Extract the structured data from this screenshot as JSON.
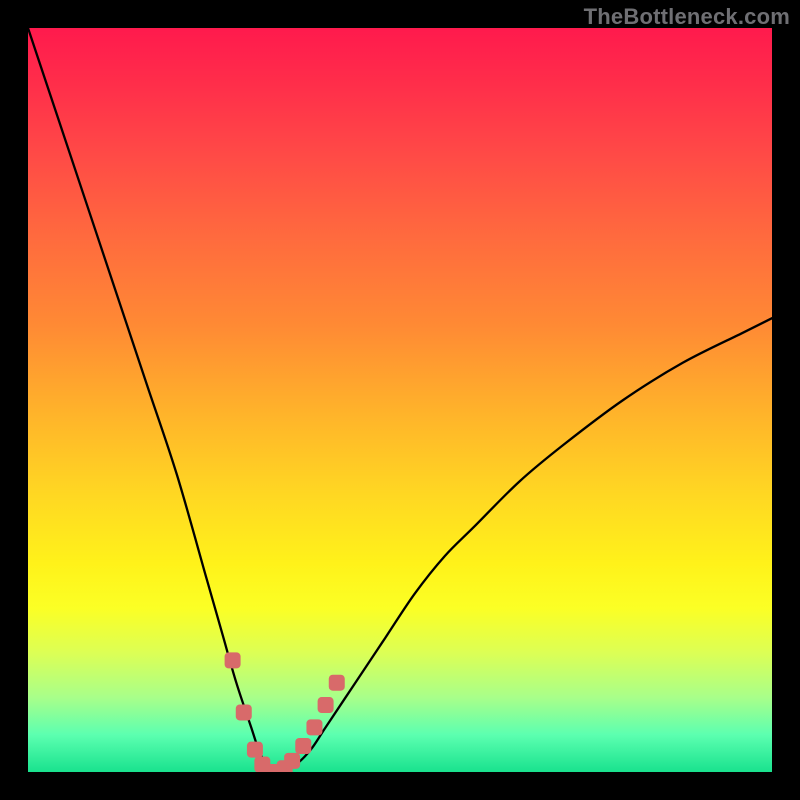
{
  "watermark": "TheBottleneck.com",
  "chart_data": {
    "type": "line",
    "title": "",
    "xlabel": "",
    "ylabel": "",
    "xlim": [
      0,
      100
    ],
    "ylim": [
      0,
      100
    ],
    "grid": false,
    "series": [
      {
        "name": "bottleneck-curve",
        "x": [
          0,
          4,
          8,
          12,
          16,
          20,
          24,
          26,
          28,
          30,
          31,
          32,
          33,
          34,
          36,
          38,
          40,
          44,
          48,
          52,
          56,
          60,
          66,
          72,
          80,
          88,
          96,
          100
        ],
        "values": [
          100,
          88,
          76,
          64,
          52,
          40,
          26,
          19,
          12,
          6,
          3,
          1,
          0,
          0,
          1,
          3,
          6,
          12,
          18,
          24,
          29,
          33,
          39,
          44,
          50,
          55,
          59,
          61
        ]
      }
    ],
    "markers": {
      "name": "trough-markers",
      "color": "#d86a6a",
      "points": [
        {
          "x": 27.5,
          "y": 15
        },
        {
          "x": 29.0,
          "y": 8
        },
        {
          "x": 30.5,
          "y": 3
        },
        {
          "x": 31.5,
          "y": 1
        },
        {
          "x": 32.5,
          "y": 0
        },
        {
          "x": 33.5,
          "y": 0
        },
        {
          "x": 34.5,
          "y": 0.5
        },
        {
          "x": 35.5,
          "y": 1.5
        },
        {
          "x": 37.0,
          "y": 3.5
        },
        {
          "x": 38.5,
          "y": 6
        },
        {
          "x": 40.0,
          "y": 9
        },
        {
          "x": 41.5,
          "y": 12
        }
      ]
    }
  },
  "colors": {
    "curve": "#000000",
    "marker": "#d86a6a",
    "frame": "#000000"
  }
}
